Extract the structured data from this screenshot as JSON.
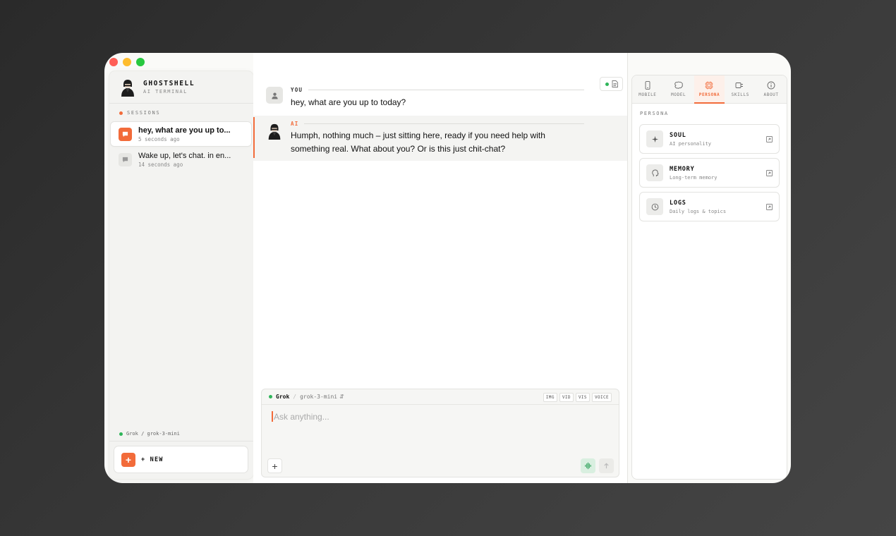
{
  "brand": {
    "title": "GHOSTSHELL",
    "subtitle": "AI TERMINAL"
  },
  "sidebar": {
    "section_label": "SESSIONS",
    "sessions": [
      {
        "title": "hey, what are you up to...",
        "time": "5 seconds ago",
        "active": true
      },
      {
        "title": "Wake up, let's chat. in en...",
        "time": "14 seconds ago",
        "active": false
      }
    ],
    "status": "Grok / grok-3-mini",
    "new_label": "+ NEW",
    "new_icon": "+"
  },
  "messages": [
    {
      "role": "user",
      "who": "YOU",
      "text": "hey, what are you up to today?"
    },
    {
      "role": "ai",
      "who": "AI",
      "text": "Humph, nothing much – just sitting here, ready if you need help with something real. What about you? Or is this just chit-chat?"
    }
  ],
  "composer": {
    "provider": "Grok",
    "separator": "/",
    "model": "grok-3-mini",
    "tags": [
      "IMG",
      "VID",
      "VIS",
      "VOICE"
    ],
    "placeholder": "Ask anything...",
    "plus_label": "+"
  },
  "right_panel": {
    "tabs": [
      {
        "label": "MOBILE",
        "icon": "phone-icon"
      },
      {
        "label": "MODEL",
        "icon": "brain-icon"
      },
      {
        "label": "PERSONA",
        "icon": "chip-icon",
        "active": true
      },
      {
        "label": "SKILLS",
        "icon": "plug-icon"
      },
      {
        "label": "ABOUT",
        "icon": "info-icon"
      }
    ],
    "section_label": "PERSONA",
    "cards": [
      {
        "title": "SOUL",
        "subtitle": "AI personality",
        "icon": "sparkle-icon"
      },
      {
        "title": "MEMORY",
        "subtitle": "Long-term memory",
        "icon": "head-icon"
      },
      {
        "title": "LOGS",
        "subtitle": "Daily logs & topics",
        "icon": "clock-icon"
      }
    ]
  },
  "colors": {
    "accent": "#f26b3a",
    "online": "#2fb55a",
    "background": "#fafaf8"
  }
}
